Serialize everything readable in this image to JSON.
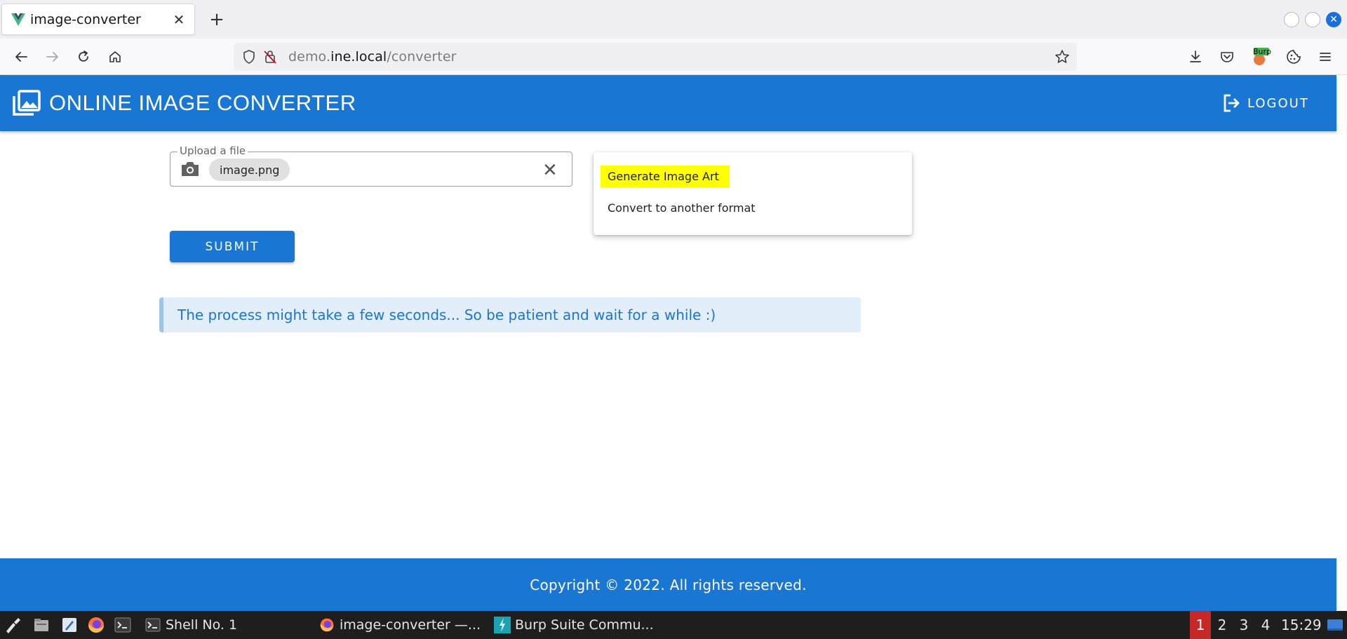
{
  "browser": {
    "tab_title": "image-converter",
    "tab_close": "✕",
    "new_tab": "+",
    "url_prefix": "demo.",
    "url_domain": "ine.local",
    "url_path": "/converter"
  },
  "header": {
    "title": "ONLINE IMAGE CONVERTER",
    "logout_label": "LOGOUT"
  },
  "upload": {
    "legend": "Upload a file",
    "file_name": "image.png",
    "clear": "✕"
  },
  "submit_label": "SUBMIT",
  "menu": {
    "items": [
      {
        "label": "Generate Image Art"
      },
      {
        "label": "Convert to another format"
      }
    ]
  },
  "alert_text": "The process might take a few seconds... So be patient and wait for a while :)",
  "footer_text": "Copyright © 2022. All rights reserved.",
  "taskbar": {
    "tasks": [
      {
        "label": "Shell No. 1"
      },
      {
        "label": "image-converter —..."
      },
      {
        "label": "Burp Suite Commu..."
      }
    ],
    "workspaces": [
      "1",
      "2",
      "3",
      "4"
    ],
    "clock": "15:29",
    "burp_badge": "Burp"
  },
  "colors": {
    "primary": "#1976d2",
    "highlight": "#ffff00",
    "alert_bg": "#e3eefb",
    "workspace_active": "#c62828"
  }
}
